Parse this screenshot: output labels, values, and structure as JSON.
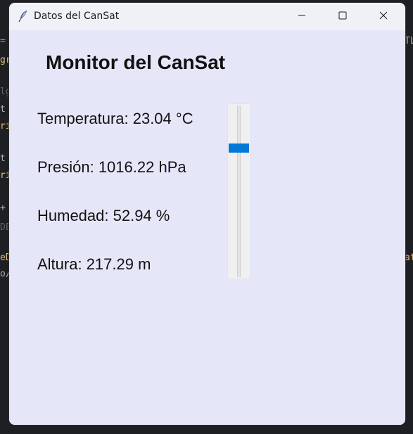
{
  "window": {
    "title": "Datos del CanSat",
    "icon": "feather-icon",
    "controls": [
      "minimize-icon",
      "maximize-icon",
      "close-icon"
    ]
  },
  "main": {
    "title": "Monitor del CanSat",
    "readings": {
      "temperatura": "Temperatura: 23.04 °C",
      "presion": "Presión: 1016.22 hPa",
      "humedad": "Humedad: 52.94 %",
      "altura": "Altura: 217.29 m"
    }
  },
  "scale": {
    "position_fraction": 0.24
  },
  "background_editor": {
    "fragments": [
      "=",
      "gr",
      "lg",
      "t",
      "ri",
      "t",
      "ri",
      "+",
      "DE",
      "eD",
      "o/",
      "TL",
      "at"
    ]
  },
  "colors": {
    "window_bg": "#e6e6f9",
    "titlebar_bg": "#eff1f7",
    "thumb": "#0078d7",
    "editor_bg": "#1e1f22"
  }
}
